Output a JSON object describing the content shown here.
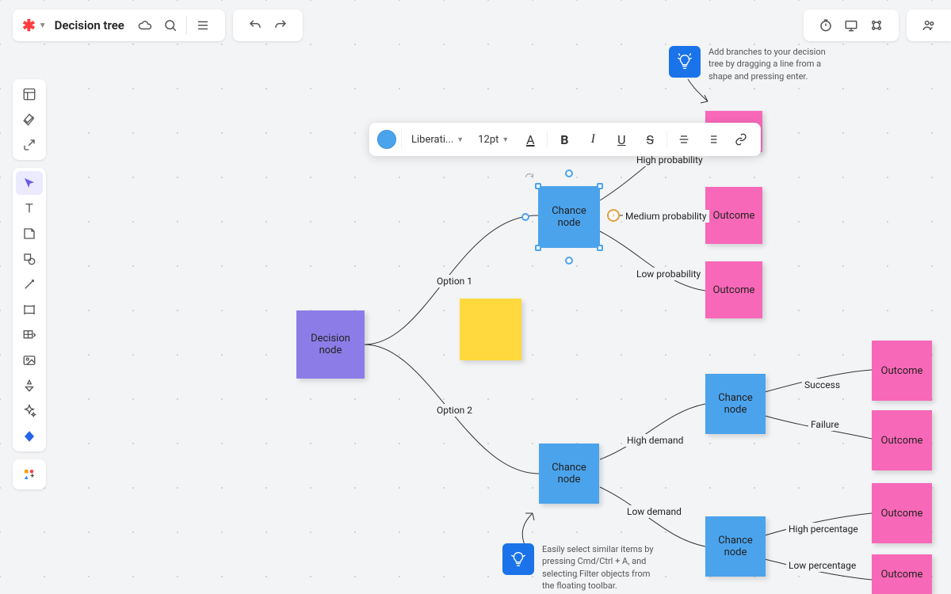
{
  "header": {
    "title": "Decision tree"
  },
  "format": {
    "font": "Liberati...",
    "size": "12pt"
  },
  "tips": {
    "top": "Add branches to your decision tree by dragging a line from a shape and pressing enter.",
    "bottom": "Easily select similar items by pressing Cmd/Ctrl + A, and selecting Filter objects from the floating toolbar."
  },
  "nodes": {
    "decision": "Decision node",
    "chance1": "Chance node",
    "chance2": "Chance node",
    "chance3": "Chance node",
    "chance4": "Chance node",
    "outcome": "Outcome"
  },
  "labels": {
    "opt1": "Option 1",
    "opt2": "Option 2",
    "high_prob": "High probability",
    "med_prob": "Medium probability",
    "low_prob": "Low probability",
    "high_dem": "High demand",
    "low_dem": "Low demand",
    "success": "Success",
    "failure": "Failure",
    "high_pct": "High percentage",
    "low_pct": "Low percentage"
  }
}
